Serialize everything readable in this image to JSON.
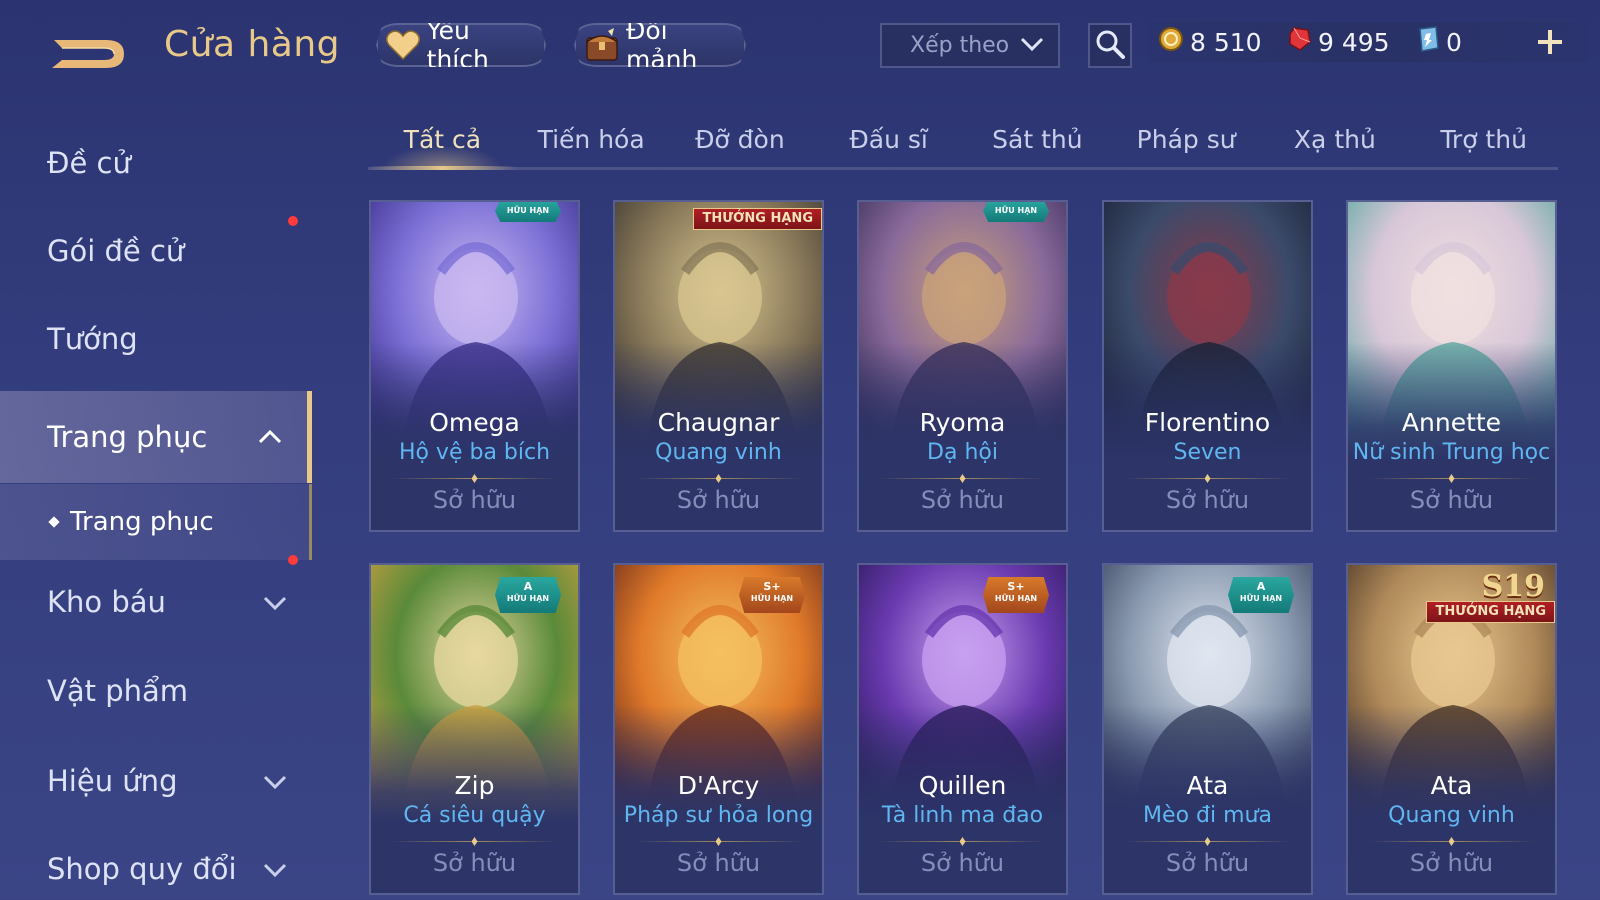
{
  "header": {
    "title": "Cửa hàng",
    "favorite_label": "Yêu thích",
    "exchange_label": "Đổi mảnh",
    "sort_label": "Xếp theo",
    "currencies": {
      "gold": "8 510",
      "ruby": "9 495",
      "voucher": "0"
    }
  },
  "sidebar": {
    "items": [
      {
        "label": "Đề cử"
      },
      {
        "label": "Gói đề cử"
      },
      {
        "label": "Tướng"
      },
      {
        "label": "Trang phục"
      },
      {
        "label": "Kho báu"
      },
      {
        "label": "Vật phẩm"
      },
      {
        "label": "Hiệu ứng"
      },
      {
        "label": "Shop quy đổi"
      }
    ],
    "sub_item": "Trang phục"
  },
  "tabs": [
    "Tất cả",
    "Tiến hóa",
    "Đỡ đòn",
    "Đấu sĩ",
    "Sát thủ",
    "Pháp sư",
    "Xạ thủ",
    "Trợ thủ"
  ],
  "cards": [
    {
      "hero": "Omega",
      "skin": "Hộ vệ ba bích",
      "status": "Sở hữu",
      "badge": "HỮU HẠN",
      "tier": "",
      "colors": [
        "#7b6fd6",
        "#3b2f8a",
        "#c9b8f0"
      ]
    },
    {
      "hero": "Chaugnar",
      "skin": "Quang vinh",
      "status": "Sở hữu",
      "badge": "THƯỞNG HẠNG",
      "tier": "",
      "colors": [
        "#8a7a5a",
        "#3a3530",
        "#d8c690"
      ]
    },
    {
      "hero": "Ryoma",
      "skin": "Dạ hội",
      "status": "Sở hữu",
      "badge": "HỮU HẠN",
      "tier": "",
      "colors": [
        "#8a6a9a",
        "#3a2f5a",
        "#c9a27a"
      ]
    },
    {
      "hero": "Florentino",
      "skin": "Seven",
      "status": "Sở hữu",
      "badge": "",
      "tier": "",
      "colors": [
        "#3a4a6a",
        "#1a2035",
        "#8a3a4a"
      ]
    },
    {
      "hero": "Annette",
      "skin": "Nữ sinh Trung học",
      "status": "Sở hữu",
      "badge": "",
      "tier": "",
      "colors": [
        "#d8c7d8",
        "#5aa8a0",
        "#f0e0e0"
      ]
    },
    {
      "hero": "Zip",
      "skin": "Cá siêu quậy",
      "status": "Sở hữu",
      "badge": "HỮU HẠN",
      "tier": "A",
      "colors": [
        "#5a8a3a",
        "#c8a040",
        "#e8d8a0"
      ]
    },
    {
      "hero": "D'Arcy",
      "skin": "Pháp sư hỏa long",
      "status": "Sở hữu",
      "badge": "HỮU HẠN",
      "tier": "S+",
      "colors": [
        "#e07a2a",
        "#6a2a1a",
        "#f4c060"
      ]
    },
    {
      "hero": "Quillen",
      "skin": "Tà linh ma đao",
      "status": "Sở hữu",
      "badge": "HỮU HẠN",
      "tier": "S+",
      "colors": [
        "#6a3ab0",
        "#2a1a5a",
        "#c8a0f0"
      ]
    },
    {
      "hero": "Ata",
      "skin": "Mèo đi mưa",
      "status": "Sở hữu",
      "badge": "HỮU HẠN",
      "tier": "A",
      "colors": [
        "#8a9ab0",
        "#3a4560",
        "#e0e6f0"
      ]
    },
    {
      "hero": "Ata",
      "skin": "Quang vinh",
      "status": "Sở hữu",
      "badge": "THƯỞNG HẠNG",
      "tier": "S19",
      "colors": [
        "#b08a5a",
        "#4a3525",
        "#e8c890"
      ]
    }
  ]
}
